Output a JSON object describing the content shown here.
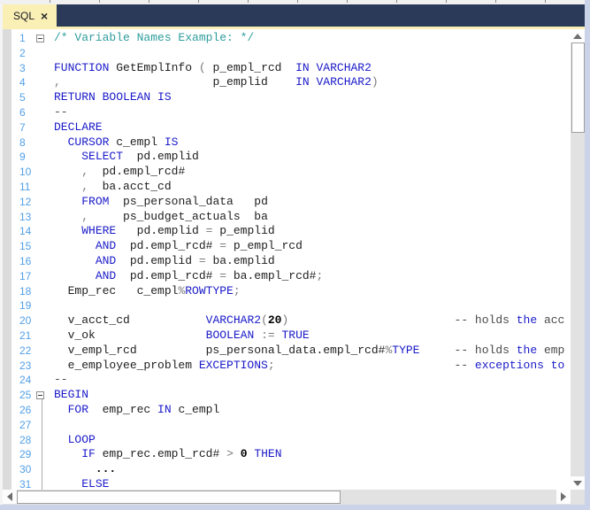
{
  "tabs": [
    {
      "label": "SQL",
      "close_glyph": "×",
      "active": true
    }
  ],
  "colors": {
    "tab_active_bg": "#FAEFB5",
    "tabbar_bg": "#2B3A59",
    "keyword_blue": "#1A1AC9",
    "identifier_dark": "#1E1E1E",
    "operator_gray": "#7A7A7A",
    "block_comment_teal": "#2F9D9D",
    "line_comment_gray": "#4A4A4A",
    "number_literal": "#000000",
    "line_number_blue": "#52A0E8",
    "gutter_strip_gray": "#DBDBDB",
    "window_border": "#CBD3E8"
  },
  "editor": {
    "visible_line_count": 31,
    "lines": [
      {
        "n": 1,
        "fold": true,
        "seg": [
          [
            "tl",
            "/* Variable Names Example: */"
          ]
        ]
      },
      {
        "n": 2,
        "seg": []
      },
      {
        "n": 3,
        "seg": [
          [
            "kw",
            "FUNCTION"
          ],
          [
            "id",
            " GetEmplInfo "
          ],
          [
            "op",
            "("
          ],
          [
            "id",
            " p_empl_rcd  "
          ],
          [
            "kw",
            "IN"
          ],
          [
            "id",
            " "
          ],
          [
            "kw",
            "VARCHAR2"
          ]
        ]
      },
      {
        "n": 4,
        "seg": [
          [
            "op",
            ","
          ],
          [
            "id",
            "                      p_emplid    "
          ],
          [
            "kw",
            "IN"
          ],
          [
            "id",
            " "
          ],
          [
            "kw",
            "VARCHAR2"
          ],
          [
            "op",
            ")"
          ]
        ]
      },
      {
        "n": 5,
        "seg": [
          [
            "kw",
            "RETURN"
          ],
          [
            "id",
            " "
          ],
          [
            "kw",
            "BOOLEAN"
          ],
          [
            "id",
            " "
          ],
          [
            "kw",
            "IS"
          ]
        ]
      },
      {
        "n": 6,
        "seg": [
          [
            "cm",
            "--"
          ]
        ]
      },
      {
        "n": 7,
        "seg": [
          [
            "kw",
            "DECLARE"
          ]
        ]
      },
      {
        "n": 8,
        "seg": [
          [
            "id",
            "  "
          ],
          [
            "kw",
            "CURSOR"
          ],
          [
            "id",
            " c_empl "
          ],
          [
            "kw",
            "IS"
          ]
        ]
      },
      {
        "n": 9,
        "seg": [
          [
            "id",
            "    "
          ],
          [
            "kw",
            "SELECT"
          ],
          [
            "id",
            "  pd.emplid"
          ]
        ]
      },
      {
        "n": 10,
        "seg": [
          [
            "id",
            "    "
          ],
          [
            "op",
            ","
          ],
          [
            "id",
            "  pd.empl_rcd#"
          ]
        ]
      },
      {
        "n": 11,
        "seg": [
          [
            "id",
            "    "
          ],
          [
            "op",
            ","
          ],
          [
            "id",
            "  ba.acct_cd"
          ]
        ]
      },
      {
        "n": 12,
        "seg": [
          [
            "id",
            "    "
          ],
          [
            "kw",
            "FROM"
          ],
          [
            "id",
            "  ps_personal_data   pd"
          ]
        ]
      },
      {
        "n": 13,
        "seg": [
          [
            "id",
            "    "
          ],
          [
            "op",
            ","
          ],
          [
            "id",
            "     ps_budget_actuals  ba"
          ]
        ]
      },
      {
        "n": 14,
        "seg": [
          [
            "id",
            "    "
          ],
          [
            "kw",
            "WHERE"
          ],
          [
            "id",
            "   pd.emplid "
          ],
          [
            "op",
            "="
          ],
          [
            "id",
            " p_emplid"
          ]
        ]
      },
      {
        "n": 15,
        "seg": [
          [
            "id",
            "      "
          ],
          [
            "kw",
            "AND"
          ],
          [
            "id",
            "  pd.empl_rcd# "
          ],
          [
            "op",
            "="
          ],
          [
            "id",
            " p_empl_rcd"
          ]
        ]
      },
      {
        "n": 16,
        "seg": [
          [
            "id",
            "      "
          ],
          [
            "kw",
            "AND"
          ],
          [
            "id",
            "  pd.emplid "
          ],
          [
            "op",
            "="
          ],
          [
            "id",
            " ba.emplid"
          ]
        ]
      },
      {
        "n": 17,
        "seg": [
          [
            "id",
            "      "
          ],
          [
            "kw",
            "AND"
          ],
          [
            "id",
            "  pd.empl_rcd# "
          ],
          [
            "op",
            "="
          ],
          [
            "id",
            " ba.empl_rcd#"
          ],
          [
            "op",
            ";"
          ]
        ]
      },
      {
        "n": 18,
        "seg": [
          [
            "id",
            "  Emp_rec   c_empl"
          ],
          [
            "op",
            "%"
          ],
          [
            "kw",
            "ROWTYPE"
          ],
          [
            "op",
            ";"
          ]
        ]
      },
      {
        "n": 19,
        "seg": []
      },
      {
        "n": 20,
        "seg": [
          [
            "id",
            "  v_acct_cd           "
          ],
          [
            "kw",
            "VARCHAR2"
          ],
          [
            "op",
            "("
          ],
          [
            "num",
            "20"
          ],
          [
            "op",
            ")"
          ],
          [
            "id",
            "                        "
          ],
          [
            "cm",
            "-- holds "
          ],
          [
            "kw",
            "the"
          ],
          [
            "cm",
            " acc"
          ]
        ]
      },
      {
        "n": 21,
        "seg": [
          [
            "id",
            "  v_ok                "
          ],
          [
            "kw",
            "BOOLEAN"
          ],
          [
            "id",
            " "
          ],
          [
            "op",
            ":="
          ],
          [
            "id",
            " "
          ],
          [
            "kw",
            "TRUE"
          ]
        ]
      },
      {
        "n": 22,
        "seg": [
          [
            "id",
            "  v_empl_rcd          ps_personal_data.empl_rcd#"
          ],
          [
            "op",
            "%"
          ],
          [
            "kw",
            "TYPE"
          ],
          [
            "id",
            "     "
          ],
          [
            "cm",
            "-- holds "
          ],
          [
            "kw",
            "the"
          ],
          [
            "cm",
            " emp"
          ]
        ]
      },
      {
        "n": 23,
        "seg": [
          [
            "id",
            "  e_employee_problem "
          ],
          [
            "kw",
            "EXCEPTIONS"
          ],
          [
            "op",
            ";"
          ],
          [
            "id",
            "                          "
          ],
          [
            "cm",
            "-- "
          ],
          [
            "kw",
            "exceptions"
          ],
          [
            "cm",
            " "
          ],
          [
            "kw",
            "to"
          ]
        ]
      },
      {
        "n": 24,
        "seg": [
          [
            "cm",
            "--"
          ]
        ]
      },
      {
        "n": 25,
        "fold": true,
        "foldline": true,
        "seg": [
          [
            "kw",
            "BEGIN"
          ]
        ]
      },
      {
        "n": 26,
        "seg": [
          [
            "id",
            "  "
          ],
          [
            "kw",
            "FOR"
          ],
          [
            "id",
            "  emp_rec "
          ],
          [
            "kw",
            "IN"
          ],
          [
            "id",
            " c_empl"
          ]
        ]
      },
      {
        "n": 27,
        "seg": []
      },
      {
        "n": 28,
        "seg": [
          [
            "id",
            "  "
          ],
          [
            "kw",
            "LOOP"
          ]
        ]
      },
      {
        "n": 29,
        "seg": [
          [
            "id",
            "    "
          ],
          [
            "kw",
            "IF"
          ],
          [
            "id",
            " emp_rec.empl_rcd# "
          ],
          [
            "op",
            ">"
          ],
          [
            "id",
            " "
          ],
          [
            "num",
            "0"
          ],
          [
            "id",
            " "
          ],
          [
            "kw",
            "THEN"
          ]
        ]
      },
      {
        "n": 30,
        "seg": [
          [
            "id",
            "      "
          ],
          [
            "num",
            "..."
          ]
        ]
      },
      {
        "n": 31,
        "seg": [
          [
            "id",
            "    "
          ],
          [
            "kw",
            "ELSE"
          ]
        ]
      }
    ]
  }
}
